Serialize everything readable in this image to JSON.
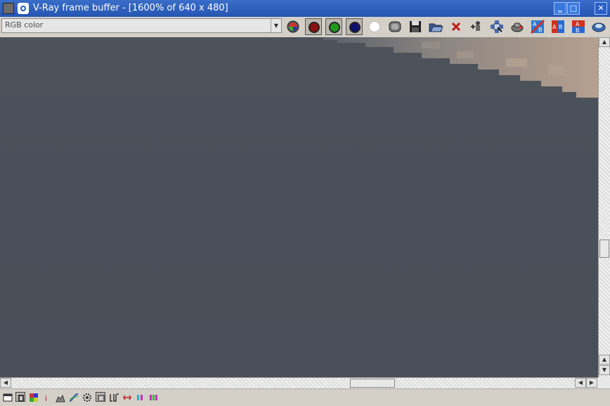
{
  "window": {
    "title": "V-Ray frame buffer - [1600% of 640 x 480]",
    "minimize_glyph": "‗",
    "maximize_glyph": "□",
    "close_glyph": "✕"
  },
  "toolbar": {
    "channel_select": {
      "value": "RGB color",
      "arrow": "▼"
    },
    "buttons": [
      {
        "name": "rgb-channels-icon"
      },
      {
        "name": "red-channel-icon",
        "color": "#8b1010",
        "pressed": true
      },
      {
        "name": "green-channel-icon",
        "color": "#1f9a1f",
        "pressed": true
      },
      {
        "name": "blue-channel-icon",
        "color": "#101070",
        "pressed": true
      },
      {
        "name": "alpha-channel-icon",
        "color": "#ffffff"
      },
      {
        "name": "monochrome-icon"
      },
      {
        "name": "save-icon"
      },
      {
        "name": "load-icon"
      },
      {
        "name": "clear-image-icon"
      },
      {
        "name": "track-mouse-icon"
      },
      {
        "name": "region-render-icon"
      },
      {
        "name": "render-last-icon"
      },
      {
        "name": "history-ab-icon"
      },
      {
        "name": "compare-ab-icon"
      },
      {
        "name": "compare-ab-vertical-icon"
      },
      {
        "name": "stereo-icon"
      }
    ]
  },
  "scrollbars": {
    "up_glyph": "▲",
    "down_glyph": "▼",
    "left_glyph": "◀",
    "right_glyph": "▶"
  },
  "statusbar": {
    "buttons": [
      {
        "name": "color-corrections-icon"
      },
      {
        "name": "display-colors-icon"
      },
      {
        "name": "color-picker-icon"
      },
      {
        "name": "info-icon"
      },
      {
        "name": "levels-icon"
      },
      {
        "name": "curves-icon"
      },
      {
        "name": "exposure-icon"
      },
      {
        "name": "lut-toggle-icon"
      },
      {
        "name": "lut-icon"
      },
      {
        "name": "ocio-icon"
      },
      {
        "name": "pixel-aspect-icon"
      },
      {
        "name": "rgb-bars-icon"
      }
    ]
  },
  "colors": {
    "canvas": "#4a5059",
    "highlight": "#b4a090",
    "titlebar": "#2456b2",
    "chrome": "#d4d0c8"
  }
}
